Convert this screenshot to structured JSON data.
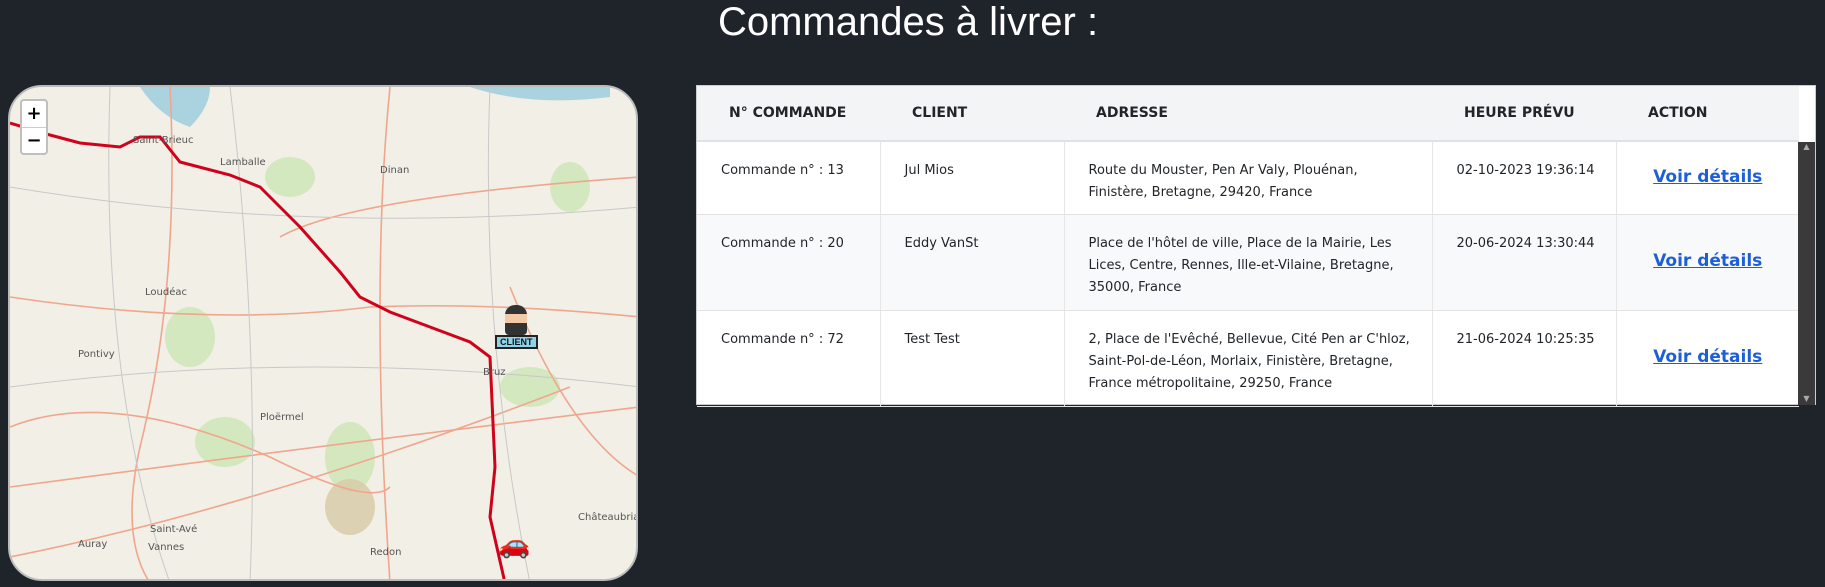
{
  "title": "Commandes à livrer :",
  "map": {
    "zoom_in": "+",
    "zoom_out": "−",
    "places": [
      "Saint-Brieuc",
      "Lamballe",
      "Dinan",
      "Loudéac",
      "Pontivy",
      "Ploërmel",
      "Bruz",
      "Saint-Avé",
      "Vannes",
      "Auray",
      "Redon",
      "Châteaubriant"
    ],
    "client_label": "CLIENT",
    "route_color": "#d0021b"
  },
  "table": {
    "headers": [
      "N° COMMANDE",
      "CLIENT",
      "ADRESSE",
      "HEURE PRÉVU",
      "ACTION"
    ],
    "rows": [
      {
        "order": "Commande n° : 13",
        "client": "Jul Mios",
        "address": "Route du Mouster, Pen Ar Valy, Plouénan, Finistère, Bretagne, 29420, France",
        "time": "02-10-2023 19:36:14",
        "action": "Voir détails"
      },
      {
        "order": "Commande n° : 20",
        "client": "Eddy VanSt",
        "address": "Place de l'hôtel de ville, Place de la Mairie, Les Lices, Centre, Rennes, Ille-et-Vilaine, Bretagne, 35000, France",
        "time": "20-06-2024 13:30:44",
        "action": "Voir détails"
      },
      {
        "order": "Commande n° : 72",
        "client": "Test Test",
        "address": "2, Place de l'Evêché, Bellevue, Cité Pen ar C'hloz, Saint-Pol-de-Léon, Morlaix, Finistère, Bretagne, France métropolitaine, 29250, France",
        "time": "21-06-2024 10:25:35",
        "action": "Voir détails"
      }
    ]
  }
}
